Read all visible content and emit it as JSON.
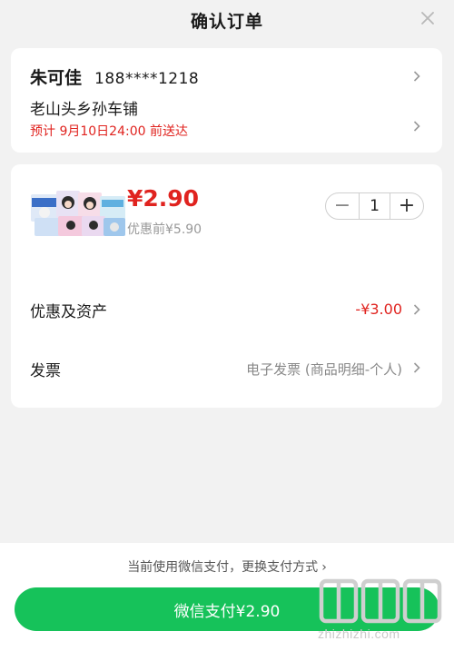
{
  "header": {
    "title": "确认订单",
    "close_icon": "close-icon"
  },
  "address": {
    "name": "朱可佳",
    "phone": "188****1218",
    "location": "老山头乡孙车铺",
    "eta": "预计 9月10日24:00 前送达"
  },
  "product": {
    "price": "¥2.90",
    "original_price": "优惠前¥5.90",
    "quantity": "1",
    "minus_label": "−",
    "plus_label": "+"
  },
  "rows": {
    "discount_label": "优惠及资产",
    "discount_value": "-¥3.00",
    "invoice_label": "发票",
    "invoice_value": "电子发票 (商品明细-个人)"
  },
  "footer": {
    "pay_method": "当前使用微信支付，更换支付方式",
    "pay_button": "微信支付¥2.90"
  },
  "watermark": {
    "text": "zhizhizhi.com"
  },
  "colors": {
    "accent_red": "#e0231f",
    "pay_green": "#16c25a"
  }
}
